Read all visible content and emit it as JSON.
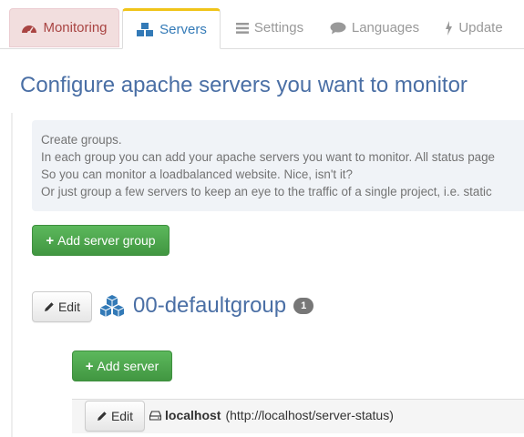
{
  "tabs": [
    {
      "label": "Monitoring",
      "icon": "dashboard-icon"
    },
    {
      "label": "Servers",
      "icon": "cubes-icon"
    },
    {
      "label": "Settings",
      "icon": "list-icon"
    },
    {
      "label": "Languages",
      "icon": "speech-bubble-icon"
    },
    {
      "label": "Update",
      "icon": "bolt-icon"
    }
  ],
  "page": {
    "title": "Configure apache servers you want to monitor",
    "info_lines": [
      "Create groups.",
      "In each group you can add your apache servers you want to monitor. All status page",
      "So you can monitor a loadbalanced website. Nice, isn't it?",
      "Or just group a few servers to keep an eye to the traffic of a single project, i.e. static"
    ],
    "add_group_label": "Add server group"
  },
  "group": {
    "edit_label": "Edit",
    "name": "00-defaultgroup",
    "count": "1",
    "add_server_label": "Add server"
  },
  "server": {
    "edit_label": "Edit",
    "host": "localhost",
    "url": "(http://localhost/server-status)"
  },
  "colors": {
    "accent_blue": "#4a6fa5",
    "success_green": "#5cb85c",
    "monitoring_tab_bg": "#f2dede",
    "active_tab_top": "#f0c419"
  }
}
